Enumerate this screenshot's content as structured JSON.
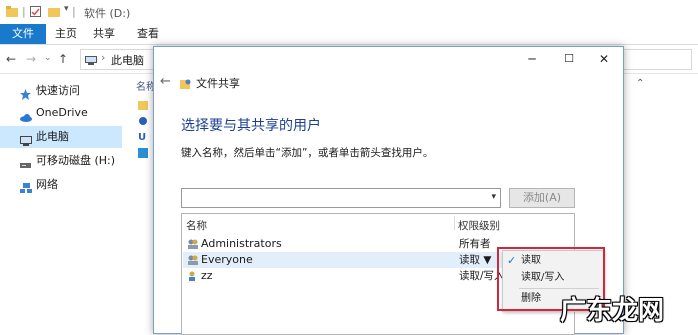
{
  "window": {
    "title": "软件 (D:)"
  },
  "ribbon": {
    "tabs": [
      "文件",
      "主页",
      "共享",
      "查看"
    ]
  },
  "address": {
    "path": "此电脑"
  },
  "sidebar": {
    "items": [
      {
        "label": "快速访问",
        "icon": "star-icon"
      },
      {
        "label": "OneDrive",
        "icon": "cloud-icon"
      },
      {
        "label": "此电脑",
        "icon": "computer-icon",
        "selected": true
      },
      {
        "label": "可移动磁盘 (H:)",
        "icon": "usb-drive-icon"
      },
      {
        "label": "网络",
        "icon": "network-icon"
      }
    ]
  },
  "content": {
    "col_name": "名称"
  },
  "dialog": {
    "title": "文件共享",
    "heading": "选择要与其共享的用户",
    "instruction": "键入名称，然后单击“添加”，或者单击箭头查找用户。",
    "input_value": "",
    "add_button": "添加(A)",
    "columns": [
      "名称",
      "权限级别"
    ],
    "rows": [
      {
        "name": "Administrators",
        "permission": "所有者"
      },
      {
        "name": "Everyone",
        "permission": "读取 ▼"
      },
      {
        "name": "zz",
        "permission": "读取/写入"
      }
    ]
  },
  "permission_menu": {
    "items": [
      {
        "label": "读取",
        "checked": true
      },
      {
        "label": "读取/写入",
        "checked": false
      },
      {
        "label": "删除",
        "checked": false
      }
    ]
  },
  "watermark": "广东龙网",
  "colors": {
    "accent": "#1979ca",
    "highlight": "#d0283a",
    "heading": "#1e3f94"
  }
}
